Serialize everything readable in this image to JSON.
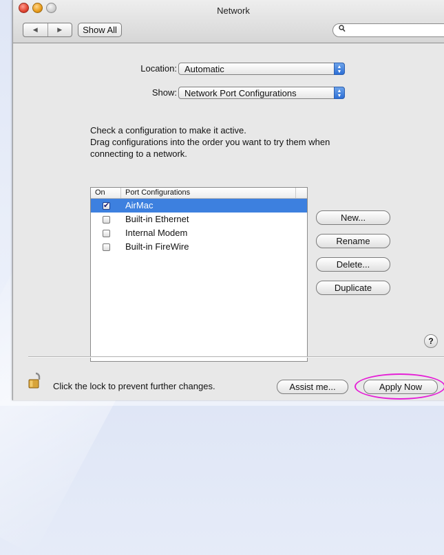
{
  "window": {
    "title": "Network"
  },
  "toolbar": {
    "back_glyph": "◀",
    "forward_glyph": "▶",
    "show_all_label": "Show All",
    "search_value": "",
    "search_icon": "magnifier-icon"
  },
  "location": {
    "label": "Location:",
    "value": "Automatic"
  },
  "show": {
    "label": "Show:",
    "value": "Network Port Configurations"
  },
  "instructions": {
    "line1": "Check a configuration to make it active.",
    "line2": "Drag configurations into the order you want to try them when",
    "line3": "connecting to a network."
  },
  "ports_table": {
    "headers": {
      "on": "On",
      "name": "Port Configurations"
    },
    "rows": [
      {
        "name": "AirMac",
        "checked": true,
        "selected": true
      },
      {
        "name": "Built-in Ethernet",
        "checked": false,
        "selected": false
      },
      {
        "name": "Internal Modem",
        "checked": false,
        "selected": false
      },
      {
        "name": "Built-in FireWire",
        "checked": false,
        "selected": false
      }
    ]
  },
  "buttons": {
    "new": "New...",
    "rename": "Rename",
    "delete": "Delete...",
    "duplicate": "Duplicate",
    "help": "?",
    "assist": "Assist me...",
    "apply": "Apply Now"
  },
  "footer": {
    "lock_text": "Click the lock to prevent further changes."
  },
  "colors": {
    "selection": "#3d80df",
    "highlight_ring": "#e51fd6",
    "popup_arrows": "#2d6fd6"
  }
}
